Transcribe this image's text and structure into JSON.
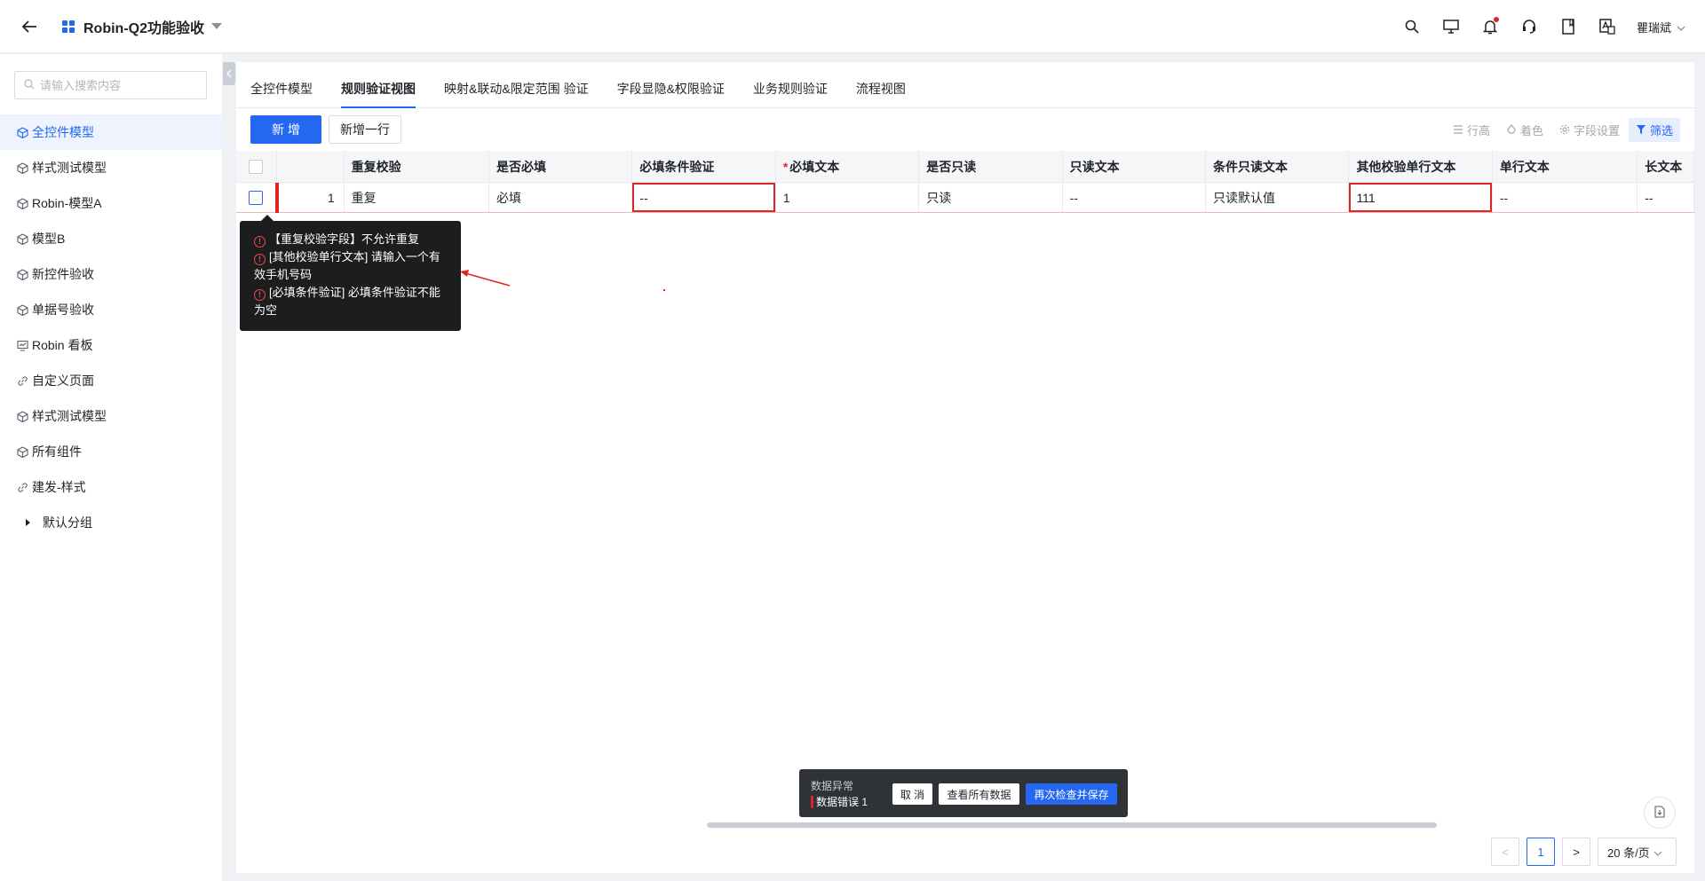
{
  "header": {
    "app_title": "Robin-Q2功能验收",
    "user_name": "瞿瑞斌"
  },
  "sidebar": {
    "search_placeholder": "请输入搜索内容",
    "items": [
      {
        "label": "全控件模型",
        "icon": "cube-icon",
        "active": true
      },
      {
        "label": "样式测试模型",
        "icon": "cube-icon"
      },
      {
        "label": "Robin-模型A",
        "icon": "cube-icon"
      },
      {
        "label": "模型B",
        "icon": "cube-icon"
      },
      {
        "label": "新控件验收",
        "icon": "cube-icon"
      },
      {
        "label": "单据号验收",
        "icon": "cube-icon"
      },
      {
        "label": "Robin 看板",
        "icon": "dashboard-icon"
      },
      {
        "label": "自定义页面",
        "icon": "link-icon"
      },
      {
        "label": "样式测试模型",
        "icon": "cube-icon"
      },
      {
        "label": "所有组件",
        "icon": "cube-icon"
      },
      {
        "label": "建发-样式",
        "icon": "link-icon"
      },
      {
        "label": "默认分组",
        "icon": "caret-right-icon"
      }
    ]
  },
  "tabs": [
    "全控件模型",
    "规则验证视图",
    "映射&联动&限定范围 验证",
    "字段显隐&权限验证",
    "业务规则验证",
    "流程视图"
  ],
  "toolbar": {
    "add_label": "新 增",
    "add_row_label": "新增一行",
    "row_height_label": "行高",
    "color_label": "着色",
    "field_settings_label": "字段设置",
    "filter_label": "筛选"
  },
  "table": {
    "columns": [
      "重复校验",
      "是否必填",
      "必填条件验证",
      "必填文本",
      "是否只读",
      "只读文本",
      "条件只读文本",
      "其他校验单行文本",
      "单行文本",
      "长文本"
    ],
    "required_marker": "*",
    "rows": [
      {
        "index": "1",
        "cells": [
          "重复",
          "必填",
          "--",
          "1",
          "只读",
          "--",
          "只读默认值",
          "111",
          "--",
          "--"
        ]
      }
    ]
  },
  "tooltip": {
    "error_mark": "!",
    "errors": [
      "【重复校验字段】不允许重复",
      "[其他校验单行文本] 请输入一个有效手机号码",
      "[必填条件验证] 必填条件验证不能为空"
    ]
  },
  "error_bar": {
    "title": "数据异常",
    "count_label": "数据错误 1",
    "cancel_label": "取 消",
    "view_all_label": "查看所有数据",
    "recheck_save_label": "再次检查并保存"
  },
  "pagination": {
    "prev": "<",
    "current_page": "1",
    "next": ">",
    "page_size_label": "20 条/页"
  },
  "colors": {
    "primary": "#2468f2",
    "error": "#e02424"
  }
}
